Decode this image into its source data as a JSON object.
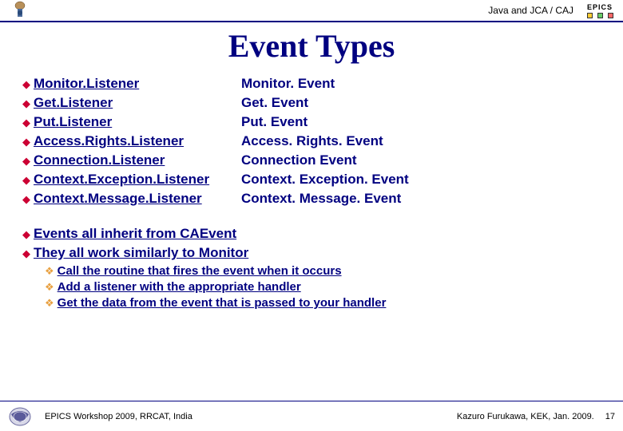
{
  "header": {
    "breadcrumb": "Java and JCA / CAJ",
    "epics_label": "EPICS"
  },
  "title": "Event Types",
  "table": [
    {
      "listener": "Monitor.Listener",
      "event": "Monitor. Event"
    },
    {
      "listener": "Get.Listener",
      "event": "Get. Event"
    },
    {
      "listener": "Put.Listener",
      "event": "Put. Event"
    },
    {
      "listener": "Access.Rights.Listener",
      "event": "Access. Rights. Event"
    },
    {
      "listener": "Connection.Listener",
      "event": "Connection Event"
    },
    {
      "listener": "Context.Exception.Listener",
      "event": "Context. Exception. Event"
    },
    {
      "listener": "Context.Message.Listener",
      "event": "Context. Message. Event"
    }
  ],
  "summary": [
    "Events all inherit from CAEvent",
    "They all work similarly to Monitor"
  ],
  "sub_points": [
    "Call the routine that fires the event when it occurs",
    "Add a listener with the appropriate handler",
    "Get the data from the event that is passed to your handler"
  ],
  "footer": {
    "left": "EPICS Workshop 2009, RRCAT, India",
    "right": "Kazuro Furukawa, KEK, Jan. 2009.",
    "page": "17"
  },
  "colors": {
    "navy": "#000080",
    "bullet_main": "#cc0033",
    "bullet_sub": "#e8a040"
  }
}
